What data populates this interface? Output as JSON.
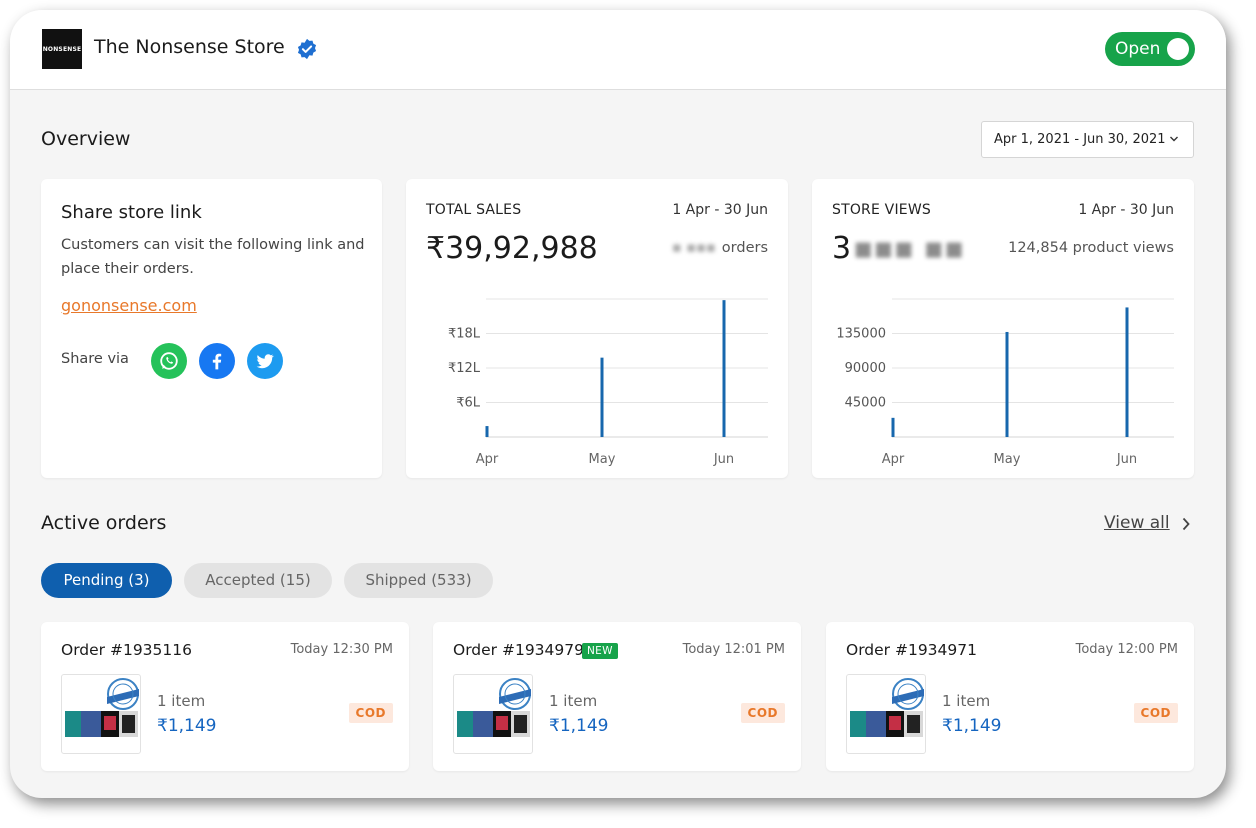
{
  "header": {
    "logo_text": "NONSENSE",
    "store_name": "The Nonsense Store",
    "status_label": "Open"
  },
  "overview": {
    "title": "Overview",
    "date_range": "Apr 1, 2021 - Jun 30, 2021"
  },
  "share": {
    "title": "Share store link",
    "description": "Customers can visit the following link and place their orders.",
    "link": "gononsense.com",
    "share_via": "Share via"
  },
  "total_sales": {
    "label": "TOTAL SALES",
    "range": "1 Apr - 30 Jun",
    "value": "₹39,92,988",
    "sub_label": "orders"
  },
  "store_views": {
    "label": "STORE VIEWS",
    "range": "1 Apr - 30 Jun",
    "value": "3",
    "sub_label": "124,854 product views"
  },
  "chart_data": [
    {
      "type": "bar",
      "categories": [
        "Apr",
        "May",
        "Jun"
      ],
      "values": [
        1.9,
        13.8,
        23.8
      ],
      "y_ticks": [
        "₹6L",
        "₹12L",
        "₹18L"
      ],
      "y_tick_values": [
        6,
        12,
        18
      ],
      "ylim": [
        0,
        24
      ],
      "grid": true,
      "color": "#1767ad"
    },
    {
      "type": "bar",
      "categories": [
        "Apr",
        "May",
        "Jun"
      ],
      "values": [
        25000,
        137000,
        169000
      ],
      "y_ticks": [
        "45000",
        "90000",
        "135000"
      ],
      "y_tick_values": [
        45000,
        90000,
        135000
      ],
      "ylim": [
        0,
        180000
      ],
      "grid": true,
      "color": "#1767ad"
    }
  ],
  "active_orders": {
    "title": "Active orders",
    "view_all": "View all",
    "tabs": [
      {
        "label": "Pending (3)"
      },
      {
        "label": "Accepted (15)"
      },
      {
        "label": "Shipped (533)"
      }
    ],
    "orders": [
      {
        "id": "Order #1935116",
        "time": "Today 12:30 PM",
        "items": "1 item",
        "price": "₹1,149",
        "payment": "COD"
      },
      {
        "id": "Order #1934979",
        "badge": "NEW",
        "time": "Today 12:01 PM",
        "items": "1 item",
        "price": "₹1,149",
        "payment": "COD"
      },
      {
        "id": "Order #1934971",
        "time": "Today 12:00 PM",
        "items": "1 item",
        "price": "₹1,149",
        "payment": "COD"
      }
    ]
  }
}
